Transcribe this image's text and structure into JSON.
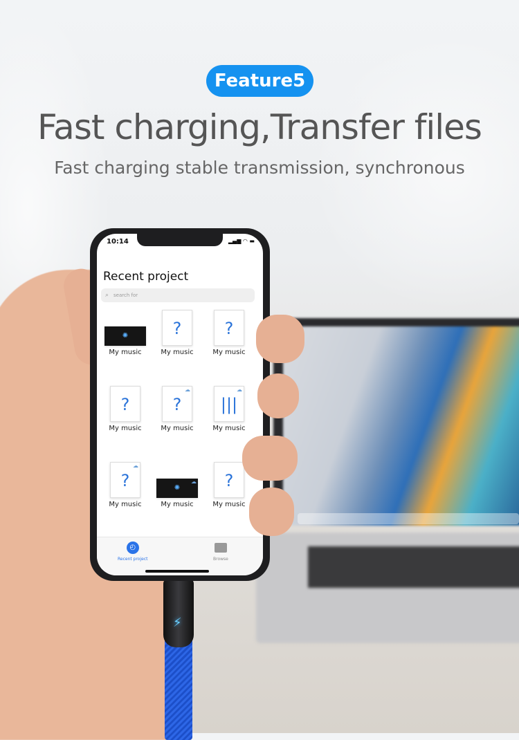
{
  "badge": "Feature5",
  "title": "Fast charging,Transfer files",
  "subtitle": "Fast charging stable transmission, synchronous",
  "phone": {
    "time": "10:14",
    "header": "Recent project",
    "search_placeholder": "search for",
    "files": [
      {
        "label": "My music",
        "type": "image"
      },
      {
        "label": "My music",
        "type": "unknown"
      },
      {
        "label": "My music",
        "type": "unknown"
      },
      {
        "label": "My music",
        "type": "unknown"
      },
      {
        "label": "My music",
        "type": "unknown-cloud"
      },
      {
        "label": "My music",
        "type": "audio-cloud"
      },
      {
        "label": "My music",
        "type": "unknown-cloud"
      },
      {
        "label": "My music",
        "type": "image-cloud"
      },
      {
        "label": "My music",
        "type": "unknown"
      }
    ],
    "tabs": [
      {
        "label": "Recent project",
        "icon": "clock-icon",
        "active": true
      },
      {
        "label": "Browse",
        "icon": "folder-icon",
        "active": false
      }
    ],
    "accent": "#2a73e8"
  },
  "colors": {
    "badge": "#1592f0",
    "cable": "#2d66e6"
  }
}
